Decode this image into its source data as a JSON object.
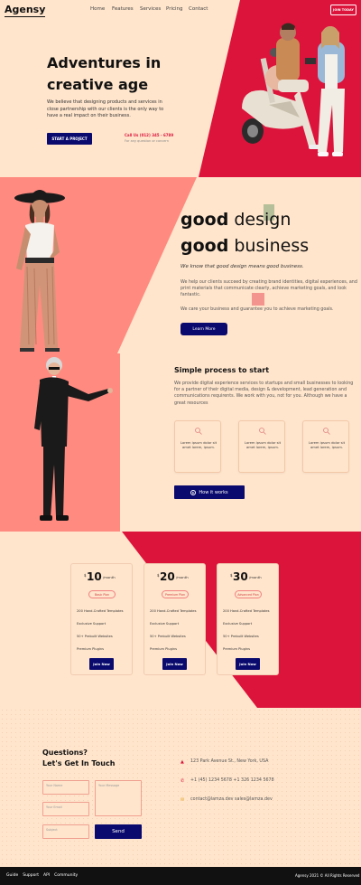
{
  "header": {
    "logo": "Agensy",
    "nav": [
      "Home",
      "Features",
      "Services",
      "Pricing",
      "Contact"
    ],
    "cta": "JOIN TODAY"
  },
  "hero": {
    "title_line1": "Adventures in",
    "title_line2": "creative age",
    "text": "We believe that designing products and services in close partnership with our clients is the only way to have a real impact on their business.",
    "button": "START A PROJECT",
    "call": "Call Us (012) 345 - 6789",
    "call_sub": "For any question or concern"
  },
  "about": {
    "good": "good",
    "design": "design",
    "business": "business",
    "italic": "We know that good design means good business.",
    "text": "We help our clients succeed by creating brand identities, digital experiences, and print materials that communicate clearly, achieve marketing goals, and look fantastic.",
    "text2": "We care your business and guarantee you to achieve marketing goals.",
    "button": "Learn More"
  },
  "process": {
    "title": "Simple process to start",
    "text": "We provide digital experience services to startups and small businesses to looking for a partner of their digital media, design & development, lead generation and communications requirents. We work with you, not for you. Although we have a great resources",
    "card_text": "Lorem ipsum dolor sit amet lorem, ipsum.",
    "button": "How it works"
  },
  "pricing": {
    "per": "/month",
    "currency": "$",
    "features": [
      "200 Hand-Crafted Templates",
      "Exclusive Support",
      "50+ Prebuilt Websites",
      "Premium Plugins"
    ],
    "join": "Join Now",
    "plans": [
      {
        "amount": "10",
        "tag": "Basic Plan"
      },
      {
        "amount": "20",
        "tag": "Premium Plan"
      },
      {
        "amount": "30",
        "tag": "Advanced Plan"
      }
    ]
  },
  "contact": {
    "q1": "Questions?",
    "q2": "Let's Get In Touch",
    "name_ph": "Your Name",
    "email_ph": "Your Email",
    "subject_ph": "Subject",
    "message_ph": "Your Message",
    "send": "Send",
    "address": "123 Park Avenue St., New York, USA",
    "phone": "+1 (45) 1234 5678   +1 326 1234 5678",
    "email": "contact@lamza.dev   sales@lamza.dev"
  },
  "footer": {
    "links": [
      "Guide",
      "Support",
      "API",
      "Community"
    ],
    "copyright": "Agensy 2021 © All Rights Reserved"
  },
  "colors": {
    "peach": "#ffe5cc",
    "red": "#dc143c",
    "salmon": "#ff8a80",
    "navy": "#0a0a6e"
  }
}
